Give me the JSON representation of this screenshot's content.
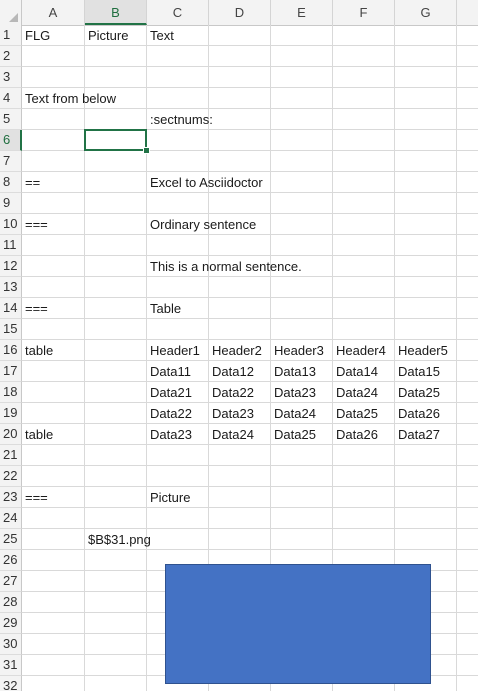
{
  "sheet": {
    "columns": [
      "A",
      "B",
      "C",
      "D",
      "E",
      "F",
      "G"
    ],
    "selected_column": "B",
    "rows": [
      "1",
      "2",
      "3",
      "4",
      "5",
      "6",
      "7",
      "8",
      "9",
      "10",
      "11",
      "12",
      "13",
      "14",
      "15",
      "16",
      "17",
      "18",
      "19",
      "20",
      "21",
      "22",
      "23",
      "24",
      "25",
      "26",
      "27",
      "28",
      "29",
      "30",
      "31",
      "32"
    ],
    "selected_row": "6",
    "active_cell": "B6",
    "cells": [
      {
        "ref": "A1",
        "value": "FLG"
      },
      {
        "ref": "B1",
        "value": "Picture"
      },
      {
        "ref": "C1",
        "value": "Text"
      },
      {
        "ref": "A4",
        "value": "Text from below"
      },
      {
        "ref": "C5",
        "value": ":sectnums:"
      },
      {
        "ref": "A8",
        "value": "=="
      },
      {
        "ref": "C8",
        "value": "Excel to Asciidoctor"
      },
      {
        "ref": "A10",
        "value": "==="
      },
      {
        "ref": "C10",
        "value": "Ordinary sentence"
      },
      {
        "ref": "C12",
        "value": "This is a normal sentence."
      },
      {
        "ref": "A14",
        "value": "==="
      },
      {
        "ref": "C14",
        "value": "Table"
      },
      {
        "ref": "A16",
        "value": "table"
      },
      {
        "ref": "C16",
        "value": "Header1"
      },
      {
        "ref": "D16",
        "value": "Header2"
      },
      {
        "ref": "E16",
        "value": "Header3"
      },
      {
        "ref": "F16",
        "value": "Header4"
      },
      {
        "ref": "G16",
        "value": "Header5"
      },
      {
        "ref": "C17",
        "value": "Data11"
      },
      {
        "ref": "D17",
        "value": "Data12"
      },
      {
        "ref": "E17",
        "value": "Data13"
      },
      {
        "ref": "F17",
        "value": "Data14"
      },
      {
        "ref": "G17",
        "value": "Data15"
      },
      {
        "ref": "C18",
        "value": "Data21"
      },
      {
        "ref": "D18",
        "value": "Data22"
      },
      {
        "ref": "E18",
        "value": "Data23"
      },
      {
        "ref": "F18",
        "value": "Data24"
      },
      {
        "ref": "G18",
        "value": "Data25"
      },
      {
        "ref": "C19",
        "value": "Data22"
      },
      {
        "ref": "D19",
        "value": "Data23"
      },
      {
        "ref": "E19",
        "value": "Data24"
      },
      {
        "ref": "F19",
        "value": "Data25"
      },
      {
        "ref": "G19",
        "value": "Data26"
      },
      {
        "ref": "A20",
        "value": "table"
      },
      {
        "ref": "C20",
        "value": "Data23"
      },
      {
        "ref": "D20",
        "value": "Data24"
      },
      {
        "ref": "E20",
        "value": "Data25"
      },
      {
        "ref": "F20",
        "value": "Data26"
      },
      {
        "ref": "G20",
        "value": "Data27"
      },
      {
        "ref": "A23",
        "value": "==="
      },
      {
        "ref": "C23",
        "value": "Picture"
      },
      {
        "ref": "B25",
        "value": "$B$31.png"
      }
    ]
  },
  "colors": {
    "accent": "#217346",
    "picture_fill": "#4472c4",
    "picture_border": "#2f528f"
  },
  "picture": {
    "anchor_cell": "C26"
  }
}
